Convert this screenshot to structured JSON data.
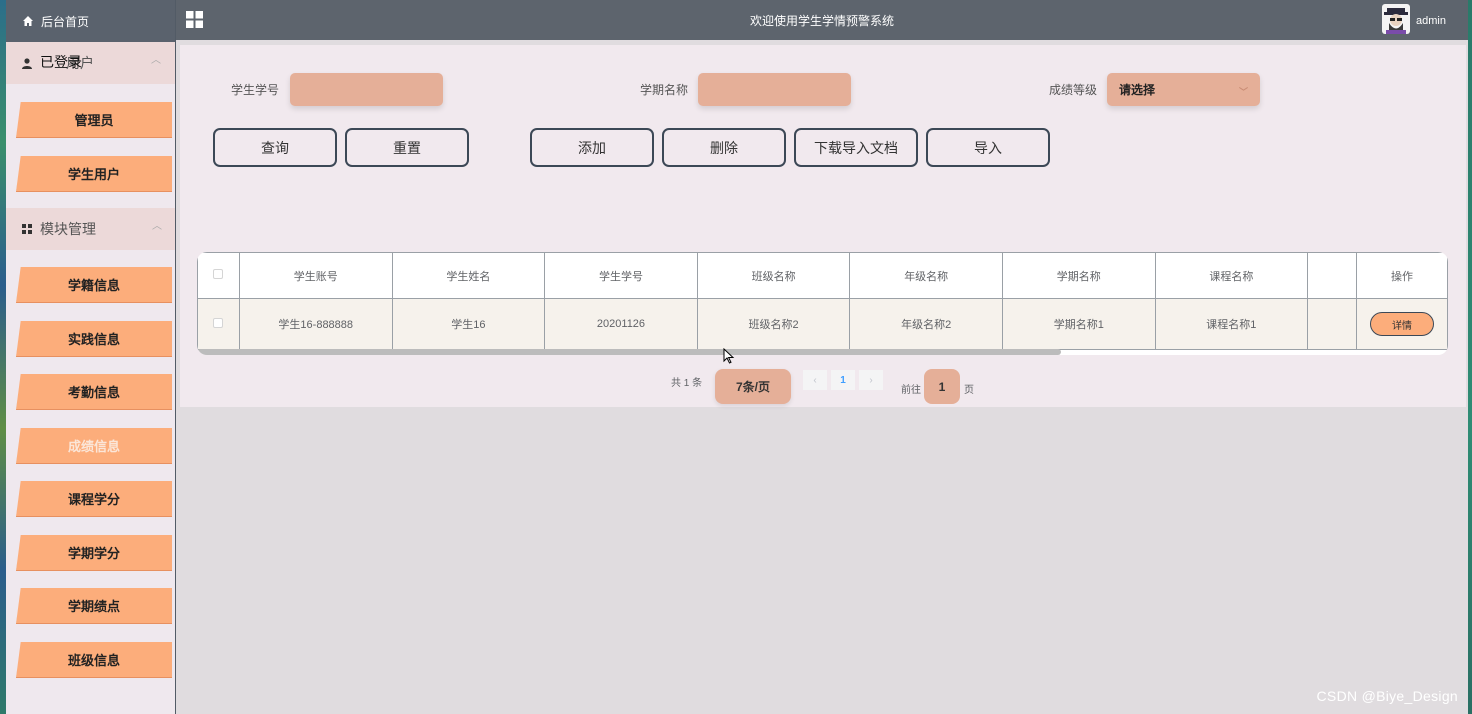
{
  "sidebar": {
    "home_label": "后台首页",
    "groups": [
      {
        "label": "用户",
        "overlay_label": "已登录",
        "items": [
          "管理员",
          "学生用户"
        ]
      },
      {
        "label": "模块管理",
        "items": [
          "学籍信息",
          "实践信息",
          "考勤信息",
          "成绩信息",
          "课程学分",
          "学期学分",
          "学期绩点",
          "班级信息"
        ]
      }
    ]
  },
  "topbar": {
    "title": "欢迎使用学生学情预警系统",
    "user": "admin"
  },
  "search": {
    "student_no_label": "学生学号",
    "student_no_value": "",
    "term_label": "学期名称",
    "term_value": "",
    "grade_label": "成绩等级",
    "grade_select": "请选择"
  },
  "buttons": {
    "query": "查询",
    "reset": "重置",
    "add": "添加",
    "delete": "删除",
    "download_template": "下载导入文档",
    "import": "导入"
  },
  "table": {
    "columns": [
      "学生账号",
      "学生姓名",
      "学生学号",
      "班级名称",
      "年级名称",
      "学期名称",
      "课程名称",
      "",
      "操作"
    ],
    "rows": [
      [
        "学生16-888888",
        "学生16",
        "20201126",
        "班级名称2",
        "年级名称2",
        "学期名称1",
        "课程名称1",
        ""
      ]
    ],
    "action_label": "详情"
  },
  "pagination": {
    "total_text": "共 1 条",
    "page_size": "7条/页",
    "current_page": "1",
    "goto_label": "前往",
    "goto_value": "1",
    "page_unit": "页"
  },
  "watermark": "CSDN @Biye_Design"
}
